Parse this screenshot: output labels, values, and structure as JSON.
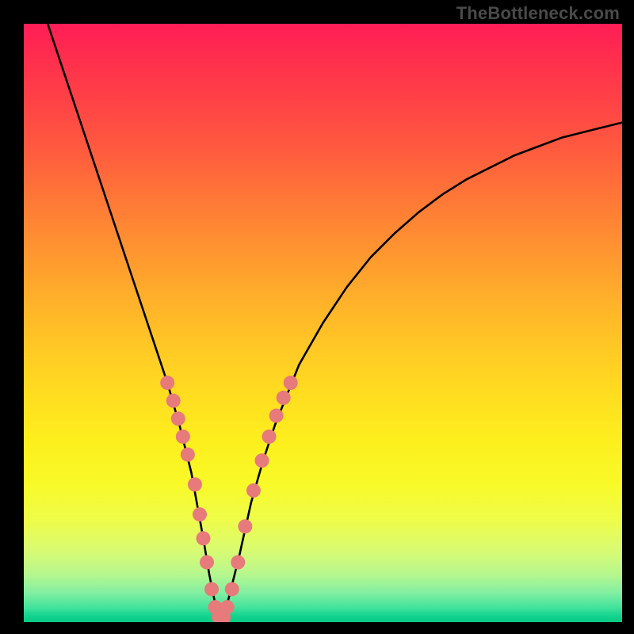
{
  "watermark": "TheBottleneck.com",
  "chart_data": {
    "type": "line",
    "title": "",
    "xlabel": "",
    "ylabel": "",
    "xlim": [
      0,
      100
    ],
    "ylim": [
      0,
      100
    ],
    "curve": {
      "name": "bottleneck-curve",
      "x": [
        4,
        6,
        8,
        10,
        12,
        14,
        16,
        18,
        20,
        22,
        24,
        26,
        28,
        30,
        31,
        32,
        33,
        34,
        36,
        38,
        40,
        42,
        44,
        46,
        50,
        54,
        58,
        62,
        66,
        70,
        74,
        78,
        82,
        86,
        90,
        94,
        98,
        100
      ],
      "y": [
        100,
        94,
        88,
        82,
        76,
        70,
        64,
        58,
        52,
        46,
        40,
        33,
        25,
        14,
        8,
        3,
        0.5,
        3,
        11,
        20,
        27,
        33,
        38,
        43,
        50,
        56,
        61,
        65,
        68.5,
        71.5,
        74,
        76,
        78,
        79.5,
        81,
        82,
        83,
        83.5
      ]
    },
    "markers": {
      "name": "highlight-dots",
      "color": "#e77a7a",
      "points": [
        {
          "x": 24.0,
          "y": 40.0
        },
        {
          "x": 25.0,
          "y": 37.0
        },
        {
          "x": 25.8,
          "y": 34.0
        },
        {
          "x": 26.6,
          "y": 31.0
        },
        {
          "x": 27.4,
          "y": 28.0
        },
        {
          "x": 28.6,
          "y": 23.0
        },
        {
          "x": 29.4,
          "y": 18.0
        },
        {
          "x": 30.0,
          "y": 14.0
        },
        {
          "x": 30.6,
          "y": 10.0
        },
        {
          "x": 31.4,
          "y": 5.5
        },
        {
          "x": 32.0,
          "y": 2.5
        },
        {
          "x": 32.6,
          "y": 0.8
        },
        {
          "x": 33.4,
          "y": 0.8
        },
        {
          "x": 34.0,
          "y": 2.5
        },
        {
          "x": 34.8,
          "y": 5.5
        },
        {
          "x": 35.8,
          "y": 10.0
        },
        {
          "x": 37.0,
          "y": 16.0
        },
        {
          "x": 38.4,
          "y": 22.0
        },
        {
          "x": 39.8,
          "y": 27.0
        },
        {
          "x": 41.0,
          "y": 31.0
        },
        {
          "x": 42.2,
          "y": 34.5
        },
        {
          "x": 43.4,
          "y": 37.5
        },
        {
          "x": 44.6,
          "y": 40.0
        }
      ]
    }
  }
}
